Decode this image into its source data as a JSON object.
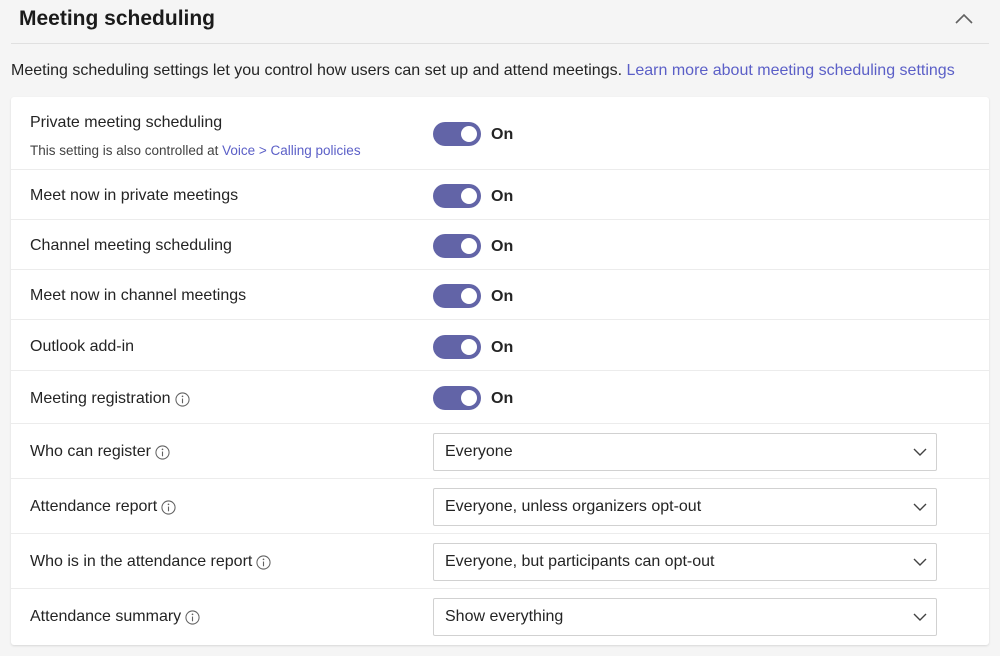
{
  "section": {
    "title": "Meeting scheduling",
    "description": "Meeting scheduling settings let you control how users can set up and attend meetings.",
    "learn_more_link": "Learn more about meeting scheduling settings"
  },
  "settings": {
    "private_meeting_scheduling": {
      "label": "Private meeting scheduling",
      "note_prefix": "This setting is also controlled at",
      "note_link": "Voice > Calling policies",
      "state": "On"
    },
    "meet_now_private": {
      "label": "Meet now in private meetings",
      "state": "On"
    },
    "channel_meeting_scheduling": {
      "label": "Channel meeting scheduling",
      "state": "On"
    },
    "meet_now_channel": {
      "label": "Meet now in channel meetings",
      "state": "On"
    },
    "outlook_addin": {
      "label": "Outlook add-in",
      "state": "On"
    },
    "meeting_registration": {
      "label": "Meeting registration",
      "state": "On"
    },
    "who_can_register": {
      "label": "Who can register",
      "value": "Everyone"
    },
    "attendance_report": {
      "label": "Attendance report",
      "value": "Everyone, unless organizers opt-out"
    },
    "who_in_attendance_report": {
      "label": "Who is in the attendance report",
      "value": "Everyone, but participants can opt-out"
    },
    "attendance_summary": {
      "label": "Attendance summary",
      "value": "Show everything"
    }
  },
  "colors": {
    "toggle_on": "#6264a7",
    "link": "#5b5fc7"
  },
  "icons": {
    "collapse": "chevron-up-icon",
    "info": "info-icon",
    "dropdown": "chevron-down-icon"
  }
}
